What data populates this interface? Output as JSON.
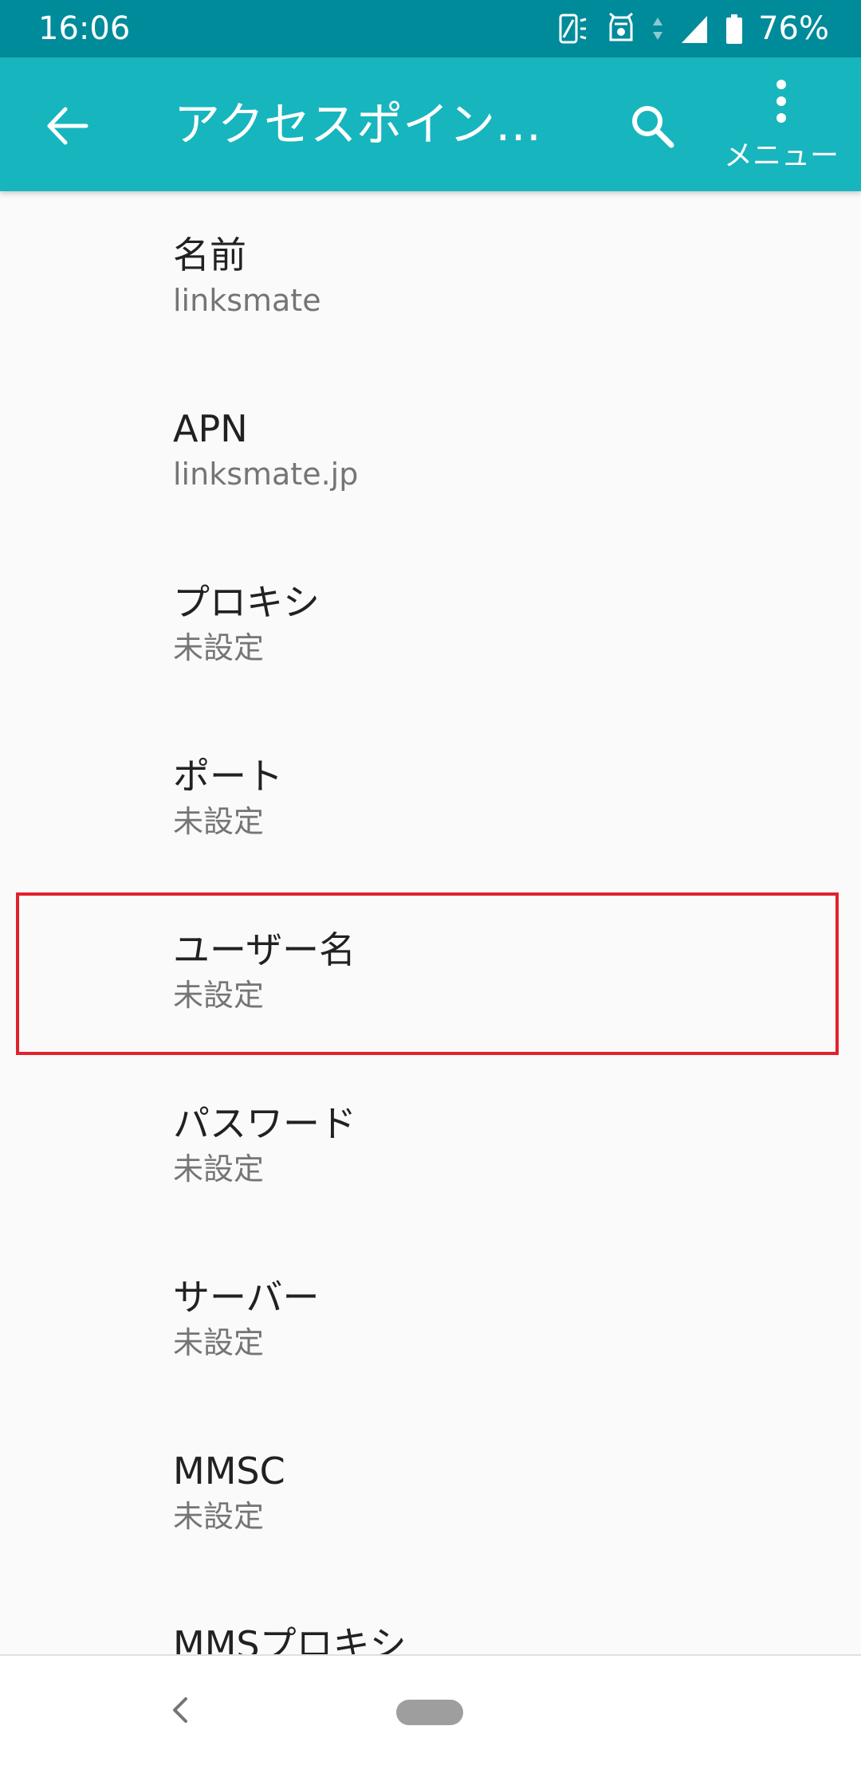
{
  "status_bar": {
    "time": "16:06",
    "battery_percent": "76%",
    "icons": [
      "screen-rotate-icon",
      "device-alert-icon",
      "data-arrows-icon",
      "signal-icon",
      "battery-icon"
    ]
  },
  "app_bar": {
    "title": "アクセスポイン…",
    "menu_label": "メニュー",
    "icons": [
      "back-arrow-icon",
      "search-icon",
      "more-vert-icon"
    ]
  },
  "items": [
    {
      "title": "名前",
      "summary": "linksmate"
    },
    {
      "title": "APN",
      "summary": "linksmate.jp"
    },
    {
      "title": "プロキシ",
      "summary": "未設定"
    },
    {
      "title": "ポート",
      "summary": "未設定"
    },
    {
      "title": "ユーザー名",
      "summary": "未設定"
    },
    {
      "title": "パスワード",
      "summary": "未設定"
    },
    {
      "title": "サーバー",
      "summary": "未設定"
    },
    {
      "title": "MMSC",
      "summary": "未設定"
    },
    {
      "title": "MMSプロキシ",
      "summary": ""
    }
  ],
  "colors": {
    "status_bar": "#008b9a",
    "app_bar": "#17b5be",
    "highlight": "#e0222d",
    "background": "#fafafa"
  },
  "nav_bar": {
    "icons": [
      "nav-back-icon",
      "home-pill-icon"
    ]
  }
}
